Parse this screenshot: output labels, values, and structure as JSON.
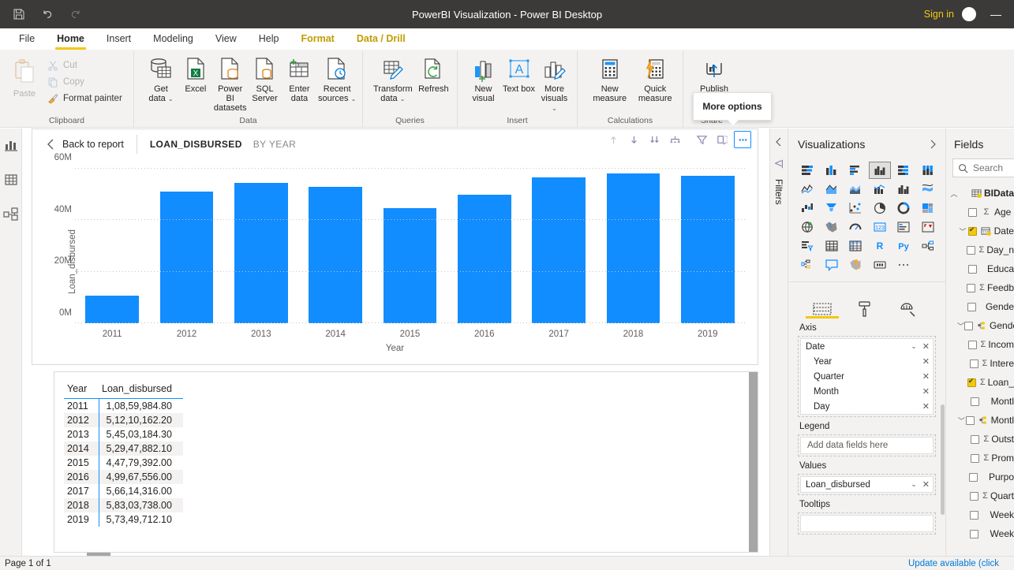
{
  "window": {
    "title": "PowerBI Visualization - Power BI Desktop",
    "save_icon": "save-icon",
    "undo_icon": "undo-icon",
    "redo_icon": "redo-icon",
    "sign_in": "Sign in",
    "minimize": "—"
  },
  "ribbon": {
    "tabs": [
      {
        "label": "File",
        "state": "normal"
      },
      {
        "label": "Home",
        "state": "active"
      },
      {
        "label": "Insert",
        "state": "normal"
      },
      {
        "label": "Modeling",
        "state": "normal"
      },
      {
        "label": "View",
        "state": "normal"
      },
      {
        "label": "Help",
        "state": "normal"
      },
      {
        "label": "Format",
        "state": "context"
      },
      {
        "label": "Data / Drill",
        "state": "context"
      }
    ],
    "groups": [
      {
        "name": "Clipboard",
        "paste": "Paste",
        "cut": "Cut",
        "copy": "Copy",
        "format_painter": "Format painter"
      },
      {
        "name": "Data",
        "items": [
          {
            "label": "Get data",
            "caret": true
          },
          {
            "label": "Excel",
            "caret": false
          },
          {
            "label": "Power BI datasets",
            "caret": false
          },
          {
            "label": "SQL Server",
            "caret": false
          },
          {
            "label": "Enter data",
            "caret": false
          },
          {
            "label": "Recent sources",
            "caret": true
          }
        ]
      },
      {
        "name": "Queries",
        "items": [
          {
            "label": "Transform data",
            "caret": true
          },
          {
            "label": "Refresh",
            "caret": false
          }
        ]
      },
      {
        "name": "Insert",
        "items": [
          {
            "label": "New visual",
            "caret": false
          },
          {
            "label": "Text box",
            "caret": false
          },
          {
            "label": "More visuals",
            "caret": true
          }
        ]
      },
      {
        "name": "Calculations",
        "items": [
          {
            "label": "New measure",
            "caret": false
          },
          {
            "label": "Quick measure",
            "caret": false
          }
        ]
      },
      {
        "name": "Share",
        "items": [
          {
            "label": "Publish",
            "caret": false
          }
        ]
      }
    ]
  },
  "tooltip": {
    "text": "More options"
  },
  "left_nav": [
    {
      "icon": "report-view-icon",
      "selected": true
    },
    {
      "icon": "data-view-icon",
      "selected": false
    },
    {
      "icon": "model-view-icon",
      "selected": false
    }
  ],
  "visual": {
    "back_to_report": "Back to report",
    "title": "LOAN_DISBURSED",
    "subtitle": "BY YEAR",
    "tools": [
      {
        "icon": "drill-up-icon",
        "active": false
      },
      {
        "icon": "drill-down-icon",
        "active": false
      },
      {
        "icon": "expand-all-icon",
        "active": false
      },
      {
        "icon": "drill-hierarchy-icon",
        "active": false
      },
      {
        "icon": "filter-icon",
        "active": false
      },
      {
        "icon": "focus-mode-icon",
        "active": false
      },
      {
        "icon": "more-options-icon",
        "active": true
      }
    ]
  },
  "chart_data": {
    "type": "bar",
    "title": "LOAN_DISBURSED BY YEAR",
    "xlabel": "Year",
    "ylabel": "Loan_disbursed",
    "categories": [
      "2011",
      "2012",
      "2013",
      "2014",
      "2015",
      "2016",
      "2017",
      "2018",
      "2019"
    ],
    "values": [
      10859984.8,
      51210162.2,
      54503184.3,
      52947882.1,
      44779392.0,
      49967556.0,
      56614316.0,
      58303738.0,
      57349712.1
    ],
    "ylim": [
      0,
      60000000
    ],
    "yticks": [
      "0M",
      "20M",
      "40M",
      "60M"
    ],
    "ytick_values": [
      0,
      20000000,
      40000000,
      60000000
    ],
    "grid": true,
    "legend": "none",
    "bar_color": "#118DFF"
  },
  "table": {
    "columns": [
      "Year",
      "Loan_disbursed"
    ],
    "rows": [
      {
        "year": "2011",
        "loan": "1,08,59,984.80"
      },
      {
        "year": "2012",
        "loan": "5,12,10,162.20"
      },
      {
        "year": "2013",
        "loan": "5,45,03,184.30"
      },
      {
        "year": "2014",
        "loan": "5,29,47,882.10"
      },
      {
        "year": "2015",
        "loan": "4,47,79,392.00"
      },
      {
        "year": "2016",
        "loan": "4,99,67,556.00"
      },
      {
        "year": "2017",
        "loan": "5,66,14,316.00"
      },
      {
        "year": "2018",
        "loan": "5,83,03,738.00"
      },
      {
        "year": "2019",
        "loan": "5,73,49,712.10"
      }
    ]
  },
  "filters_rail": {
    "label": "Filters",
    "collapse_icon": "chevron-left-icon",
    "filter_icon": "filter-icon"
  },
  "visualizations": {
    "title": "Visualizations",
    "expand_icon": "chevron-right-icon",
    "gallery": [
      {
        "icon": "stacked-bar-chart-icon",
        "selected": false
      },
      {
        "icon": "stacked-column-chart-icon",
        "selected": false
      },
      {
        "icon": "clustered-bar-chart-icon",
        "selected": false
      },
      {
        "icon": "clustered-column-chart-icon",
        "selected": true
      },
      {
        "icon": "100-stacked-bar-chart-icon",
        "selected": false
      },
      {
        "icon": "100-stacked-column-chart-icon",
        "selected": false
      },
      {
        "icon": "line-chart-icon",
        "selected": false
      },
      {
        "icon": "area-chart-icon",
        "selected": false
      },
      {
        "icon": "stacked-area-chart-icon",
        "selected": false
      },
      {
        "icon": "line-stacked-column-chart-icon",
        "selected": false
      },
      {
        "icon": "line-clustered-column-chart-icon",
        "selected": false
      },
      {
        "icon": "ribbon-chart-icon",
        "selected": false
      },
      {
        "icon": "waterfall-chart-icon",
        "selected": false
      },
      {
        "icon": "funnel-chart-icon",
        "selected": false
      },
      {
        "icon": "scatter-chart-icon",
        "selected": false
      },
      {
        "icon": "pie-chart-icon",
        "selected": false
      },
      {
        "icon": "donut-chart-icon",
        "selected": false
      },
      {
        "icon": "treemap-icon",
        "selected": false
      },
      {
        "icon": "map-icon",
        "selected": false
      },
      {
        "icon": "filled-map-icon",
        "selected": false
      },
      {
        "icon": "gauge-icon",
        "selected": false
      },
      {
        "icon": "card-icon",
        "selected": false
      },
      {
        "icon": "multi-row-card-icon",
        "selected": false
      },
      {
        "icon": "kpi-icon",
        "selected": false
      },
      {
        "icon": "slicer-icon",
        "selected": false
      },
      {
        "icon": "table-icon",
        "selected": false
      },
      {
        "icon": "matrix-icon",
        "selected": false
      },
      {
        "icon": "r-script-visual-icon",
        "selected": false
      },
      {
        "icon": "python-visual-icon",
        "selected": false
      },
      {
        "icon": "decomposition-tree-icon",
        "selected": false
      },
      {
        "icon": "key-influencers-icon",
        "selected": false
      },
      {
        "icon": "qna-icon",
        "selected": false
      },
      {
        "icon": "arcgis-map-icon",
        "selected": false
      },
      {
        "icon": "paginated-report-icon",
        "selected": false
      },
      {
        "icon": "more-visuals-ellipsis-icon",
        "selected": false
      }
    ],
    "pane_tabs": [
      {
        "icon": "fields-pane-icon",
        "selected": true
      },
      {
        "icon": "format-paintroller-icon",
        "selected": false
      },
      {
        "icon": "analytics-magnifier-icon",
        "selected": false
      }
    ],
    "wells": [
      {
        "name": "Axis",
        "fields": [
          {
            "label": "Date",
            "child": false,
            "caret": true,
            "remove": "✕"
          },
          {
            "label": "Year",
            "child": true,
            "caret": false,
            "remove": "✕"
          },
          {
            "label": "Quarter",
            "child": true,
            "caret": false,
            "remove": "✕"
          },
          {
            "label": "Month",
            "child": true,
            "caret": false,
            "remove": "✕"
          },
          {
            "label": "Day",
            "child": true,
            "caret": false,
            "remove": "✕"
          }
        ]
      },
      {
        "name": "Legend",
        "placeholder": "Add data fields here",
        "fields": []
      },
      {
        "name": "Values",
        "fields": [
          {
            "label": "Loan_disbursed",
            "child": false,
            "caret": true,
            "remove": "✕"
          }
        ]
      },
      {
        "name": "Tooltips",
        "placeholder": "",
        "fields": []
      }
    ]
  },
  "fields": {
    "title": "Fields",
    "search_placeholder": "Search",
    "search_icon": "search-icon",
    "tree": [
      {
        "label": "BIData",
        "level": 0,
        "expander": "chevron-up-icon",
        "checkbox": "none",
        "sigma": "",
        "icon": "table-icon"
      },
      {
        "label": "Age",
        "level": 1,
        "expander": "",
        "checkbox": "off",
        "sigma": "Σ",
        "icon": ""
      },
      {
        "label": "Date",
        "level": 1,
        "expander": "chevron-down-icon",
        "checkbox": "on",
        "sigma": "",
        "icon": "date-table-icon"
      },
      {
        "label": "Day_n",
        "level": 2,
        "expander": "",
        "checkbox": "off",
        "sigma": "Σ",
        "icon": ""
      },
      {
        "label": "Educa",
        "level": 2,
        "expander": "",
        "checkbox": "off",
        "sigma": "",
        "icon": ""
      },
      {
        "label": "Feedb",
        "level": 2,
        "expander": "",
        "checkbox": "off",
        "sigma": "Σ",
        "icon": ""
      },
      {
        "label": "Gende",
        "level": 2,
        "expander": "",
        "checkbox": "off",
        "sigma": "",
        "icon": ""
      },
      {
        "label": "Gende",
        "level": 1,
        "expander": "chevron-down-icon",
        "checkbox": "off",
        "sigma": "",
        "icon": "hierarchy-icon"
      },
      {
        "label": "Incom",
        "level": 2,
        "expander": "",
        "checkbox": "off",
        "sigma": "Σ",
        "icon": ""
      },
      {
        "label": "Intere",
        "level": 2,
        "expander": "",
        "checkbox": "off",
        "sigma": "Σ",
        "icon": ""
      },
      {
        "label": "Loan_",
        "level": 2,
        "expander": "",
        "checkbox": "on",
        "sigma": "Σ",
        "icon": ""
      },
      {
        "label": "Montl",
        "level": 2,
        "expander": "",
        "checkbox": "off",
        "sigma": "",
        "icon": ""
      },
      {
        "label": "Montl",
        "level": 1,
        "expander": "chevron-down-icon",
        "checkbox": "off",
        "sigma": "",
        "icon": "hierarchy-icon"
      },
      {
        "label": "Outst",
        "level": 2,
        "expander": "",
        "checkbox": "off",
        "sigma": "Σ",
        "icon": ""
      },
      {
        "label": "Prom",
        "level": 2,
        "expander": "",
        "checkbox": "off",
        "sigma": "Σ",
        "icon": ""
      },
      {
        "label": "Purpo",
        "level": 2,
        "expander": "",
        "checkbox": "off",
        "sigma": "",
        "icon": ""
      },
      {
        "label": "Quart",
        "level": 2,
        "expander": "",
        "checkbox": "off",
        "sigma": "Σ",
        "icon": ""
      },
      {
        "label": "Week",
        "level": 2,
        "expander": "",
        "checkbox": "off",
        "sigma": "",
        "icon": ""
      },
      {
        "label": "Week",
        "level": 2,
        "expander": "",
        "checkbox": "off",
        "sigma": "",
        "icon": ""
      }
    ]
  },
  "status": {
    "page": "Page 1 of 1",
    "update": "Update available (click"
  }
}
